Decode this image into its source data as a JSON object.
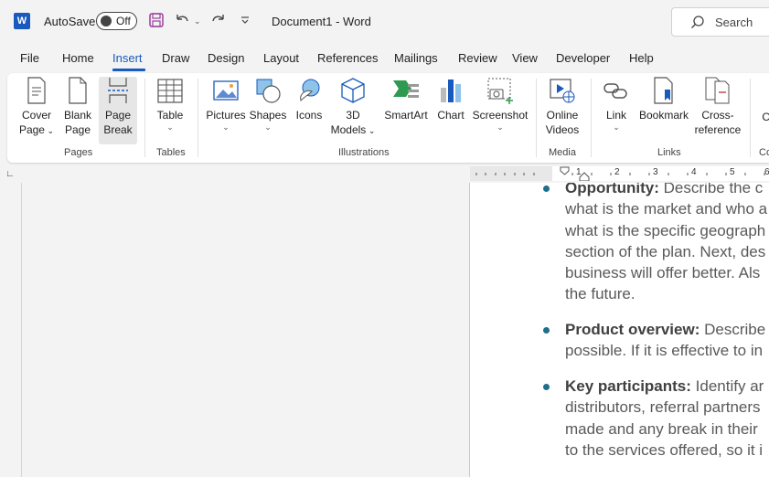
{
  "titlebar": {
    "autosave_label": "AutoSave",
    "autosave_state": "Off",
    "doc_title": "Document1  -  Word",
    "search_placeholder": "Search"
  },
  "tabs": [
    "File",
    "Home",
    "Insert",
    "Draw",
    "Design",
    "Layout",
    "References",
    "Mailings",
    "Review",
    "View",
    "Developer",
    "Help"
  ],
  "active_tab": "Insert",
  "ribbon": {
    "pages": {
      "label": "Pages",
      "cover_page_1": "Cover",
      "cover_page_2": "Page",
      "blank_page_1": "Blank",
      "blank_page_2": "Page",
      "page_break_1": "Page",
      "page_break_2": "Break"
    },
    "tables": {
      "label": "Tables",
      "table": "Table"
    },
    "illustrations": {
      "label": "Illustrations",
      "pictures": "Pictures",
      "shapes": "Shapes",
      "icons": "Icons",
      "models_1": "3D",
      "models_2": "Models",
      "smartart": "SmartArt",
      "chart": "Chart",
      "screenshot": "Screenshot"
    },
    "media": {
      "label": "Media",
      "online_videos_1": "Online",
      "online_videos_2": "Videos"
    },
    "links": {
      "label": "Links",
      "link": "Link",
      "bookmark": "Bookmark",
      "cross_ref_1": "Cross-",
      "cross_ref_2": "reference"
    },
    "comments": {
      "label": "Co",
      "comment": "Co"
    }
  },
  "ruler": {
    "numbers": [
      "1",
      "2",
      "3",
      "4",
      "5",
      "6"
    ]
  },
  "document": {
    "para1": {
      "bold": "Opportunity:",
      "lines": [
        " Describe the c",
        "what is the market and who a",
        "what is the specific geograph",
        "section of the plan. Next, des",
        "business will offer better. Als",
        "the future."
      ]
    },
    "para2": {
      "bold": "Product overview:",
      "lines": [
        " Describe",
        "possible. If it is effective to in"
      ]
    },
    "para3": {
      "bold": "Key participants:",
      "lines": [
        " Identify ar",
        "distributors, referral partners",
        "made and any break in their",
        "to the services offered, so it i"
      ]
    }
  },
  "colors": {
    "accent": "#185abd",
    "bullet": "#1f6e8c"
  }
}
